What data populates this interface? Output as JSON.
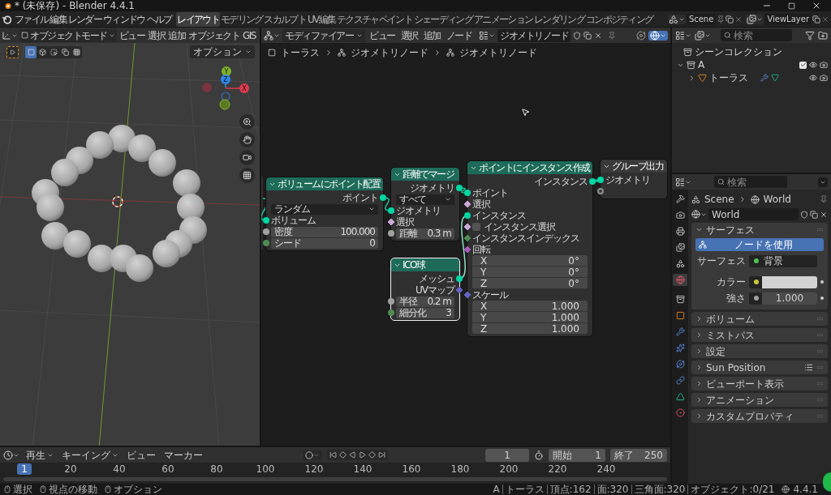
{
  "window": {
    "title": "* (未保存) - Blender 4.4.1"
  },
  "menu": [
    "ファイル",
    "編集",
    "レンダー",
    "ウィンドウ",
    "ヘルプ"
  ],
  "workspaces": [
    {
      "label": "レイアウト",
      "selected": true
    },
    {
      "label": "モデリング",
      "selected": false
    },
    {
      "label": "スカルプト",
      "selected": false
    },
    {
      "label": "UV編集",
      "selected": false
    },
    {
      "label": "テクスチャペイント",
      "selected": false
    },
    {
      "label": "シェーディング",
      "selected": false
    },
    {
      "label": "アニメーション",
      "selected": false
    },
    {
      "label": "レンダリング",
      "selected": false
    },
    {
      "label": "コンポジティング",
      "selected": false
    }
  ],
  "scene": "Scene",
  "view_layer": "ViewLayer",
  "viewport": {
    "mode": "オブジェクトモード",
    "menus": [
      "ビュー",
      "選択",
      "追加",
      "オブジェクト",
      "GIS"
    ],
    "select_modes": [
      {
        "selected": true
      },
      {
        "selected": false
      },
      {
        "selected": false
      },
      {
        "selected": false
      },
      {
        "selected": false
      }
    ],
    "options": "オプション",
    "gizmo": {
      "x": "X",
      "y": "Y",
      "z": "Z"
    }
  },
  "node_editor": {
    "editor": "モディファイアー",
    "menus": [
      "ビュー",
      "選択",
      "追加",
      "ノード"
    ],
    "tree": "ジオメトリノード",
    "breadcrumbs": [
      "トーラス",
      "ジオメトリノード",
      "ジオメトリノード"
    ],
    "nodes": [
      {
        "title": "ボリュームにポイント配置",
        "color": "#1e6b5a",
        "selected": false,
        "rows": [
          {
            "kind": "output",
            "label": "ポイント",
            "socket": {
              "color": "#00d6a3",
              "diamond": false
            }
          },
          {
            "kind": "dropdown",
            "label": "ランダム"
          },
          {
            "kind": "input",
            "label": "ボリューム",
            "socket": {
              "color": "#00d6a3",
              "diamond": false
            }
          },
          {
            "kind": "field",
            "label": "密度",
            "value": "100.000",
            "socket": {
              "color": "#a1a1a1",
              "diamond": false
            }
          },
          {
            "kind": "field",
            "label": "シード",
            "value": "0",
            "socket": {
              "color": "#4f8a52",
              "diamond": false
            }
          }
        ]
      },
      {
        "title": "距離でマージ",
        "color": "#1e6b5a",
        "selected": false,
        "rows": [
          {
            "kind": "output",
            "label": "ジオメトリ",
            "socket": {
              "color": "#00d6a3",
              "diamond": false
            }
          },
          {
            "kind": "dropdown",
            "label": "すべて"
          },
          {
            "kind": "input",
            "label": "ジオメトリ",
            "socket": {
              "color": "#00d6a3",
              "diamond": false
            }
          },
          {
            "kind": "input",
            "label": "選択",
            "socket": {
              "color": "#cca6d6",
              "diamond": true
            }
          },
          {
            "kind": "field",
            "label": "距離",
            "value": "0.3 m",
            "socket": {
              "color": "#a1a1a1",
              "diamond": false
            }
          }
        ]
      },
      {
        "title": "ICO球",
        "color": "#1e6b5a",
        "selected": true,
        "rows": [
          {
            "kind": "output",
            "label": "メッシュ",
            "socket": {
              "color": "#00d6a3",
              "diamond": false
            }
          },
          {
            "kind": "output",
            "label": "UVマップ",
            "socket": {
              "color": "#6363c7",
              "diamond": true
            }
          },
          {
            "kind": "field",
            "label": "半径",
            "value": "0.2 m",
            "socket": {
              "color": "#a1a1a1",
              "diamond": false
            }
          },
          {
            "kind": "field",
            "label": "細分化",
            "value": "3",
            "socket": {
              "color": "#4f8a52",
              "diamond": false
            }
          }
        ]
      },
      {
        "title": "ポイントにインスタンス作成",
        "color": "#1e6b5a",
        "selected": false,
        "rows": [
          {
            "kind": "output",
            "label": "インスタンス",
            "socket": {
              "color": "#00d6a3",
              "diamond": false
            }
          },
          {
            "kind": "input",
            "label": "ポイント",
            "socket": {
              "color": "#00d6a3",
              "diamond": false
            }
          },
          {
            "kind": "input",
            "label": "選択",
            "socket": {
              "color": "#cca6d6",
              "diamond": true
            }
          },
          {
            "kind": "input",
            "label": "インスタンス",
            "socket": {
              "color": "#00d6a3",
              "diamond": false
            }
          },
          {
            "kind": "checkbox",
            "label": "インスタンス選択",
            "checked": false,
            "socket": {
              "color": "#cca6d6",
              "diamond": true
            }
          },
          {
            "kind": "input",
            "label": "インスタンスインデックス",
            "socket": {
              "color": "#4f8a52",
              "diamond": true
            }
          },
          {
            "kind": "input",
            "label": "回転",
            "socket": {
              "color": "#a65bb5",
              "diamond": true
            }
          },
          {
            "kind": "vector",
            "label": "X",
            "value": "0°"
          },
          {
            "kind": "vector",
            "label": "Y",
            "value": "0°"
          },
          {
            "kind": "vector",
            "label": "Z",
            "value": "0°"
          },
          {
            "kind": "input",
            "label": "スケール",
            "socket": {
              "color": "#6363c7",
              "diamond": true
            }
          },
          {
            "kind": "vector",
            "label": "X",
            "value": "1.000"
          },
          {
            "kind": "vector",
            "label": "Y",
            "value": "1.000"
          },
          {
            "kind": "vector",
            "label": "Z",
            "value": "1.000"
          }
        ]
      },
      {
        "title": "グループ出力",
        "color": "#3a3a3a",
        "selected": false,
        "rows": [
          {
            "kind": "input",
            "label": "ジオメトリ",
            "socket": {
              "color": "#00d6a3",
              "diamond": false
            }
          },
          {
            "kind": "empty",
            "socket": {
              "color": "#8a8a8a",
              "diamond": false
            }
          }
        ]
      }
    ]
  },
  "outliner": {
    "search_placeholder": "検索",
    "tree": [
      {
        "label": "シーンコレクション",
        "kind": "scene",
        "children": [
          {
            "label": "A",
            "kind": "collection",
            "expanded": true,
            "checked": true,
            "children": [
              {
                "label": "トーラス",
                "kind": "object",
                "expanded": false
              }
            ]
          }
        ]
      }
    ]
  },
  "properties": {
    "search_placeholder": "検索",
    "tabs": [
      {
        "selected": false
      },
      {
        "selected": false
      },
      {
        "selected": false
      },
      {
        "selected": false
      },
      {
        "selected": false
      },
      {
        "selected": true
      },
      {
        "selected": false
      },
      {
        "selected": false
      },
      {
        "selected": false
      },
      {
        "selected": false
      },
      {
        "selected": false
      },
      {
        "selected": false
      },
      {
        "selected": false
      },
      {
        "selected": false
      }
    ],
    "breadcrumb": [
      "Scene",
      "World"
    ],
    "datablock": "World",
    "surface": {
      "button": "ノードを使用",
      "rows": [
        {
          "kind": "shader",
          "label": "サーフェス",
          "value": "背景",
          "color": "#4fc24f"
        },
        {
          "kind": "color",
          "label": "カラー",
          "color": "#c8c83c"
        },
        {
          "kind": "number",
          "label": "強さ",
          "value": "1.000",
          "color": "#a1a1a1"
        }
      ]
    },
    "panels": [
      {
        "title": "サーフェス",
        "expanded": true,
        "kind": "plain"
      },
      {
        "title": "ボリューム",
        "expanded": false,
        "kind": "plain"
      },
      {
        "title": "ミストパス",
        "expanded": false,
        "kind": "plain"
      },
      {
        "title": "設定",
        "expanded": false,
        "kind": "plain"
      },
      {
        "title": "Sun Position",
        "expanded": false,
        "kind": "presets"
      },
      {
        "title": "ビューポート表示",
        "expanded": false,
        "kind": "plain"
      },
      {
        "title": "アニメーション",
        "expanded": false,
        "kind": "plain"
      },
      {
        "title": "カスタムプロパティ",
        "expanded": false,
        "kind": "plain"
      }
    ]
  },
  "timeline": {
    "menus": [
      {
        "label": "再生",
        "kind": "dropdown"
      },
      {
        "label": "キーイング",
        "kind": "dropdown"
      },
      {
        "label": "ビュー",
        "kind": "plain"
      },
      {
        "label": "マーカー",
        "kind": "plain"
      }
    ],
    "current_frame": "1",
    "start_label": "開始",
    "start": "1",
    "end_label": "終了",
    "end": "250",
    "ruler": [
      {
        "label": "1",
        "selected": true
      },
      {
        "label": "20",
        "selected": false
      },
      {
        "label": "40",
        "selected": false
      },
      {
        "label": "60",
        "selected": false
      },
      {
        "label": "80",
        "selected": false
      },
      {
        "label": "100",
        "selected": false
      },
      {
        "label": "120",
        "selected": false
      },
      {
        "label": "140",
        "selected": false
      },
      {
        "label": "160",
        "selected": false
      },
      {
        "label": "180",
        "selected": false
      },
      {
        "label": "200",
        "selected": false
      },
      {
        "label": "220",
        "selected": false
      },
      {
        "label": "240",
        "selected": false
      }
    ]
  },
  "status": {
    "hints": [
      "選択",
      "視点の移動",
      "オプション"
    ],
    "stats": [
      "A",
      "トーラス",
      "頂点:162",
      "面:320",
      "三角面:320",
      "オブジェクト:0/21"
    ],
    "version": "4.4.1"
  }
}
